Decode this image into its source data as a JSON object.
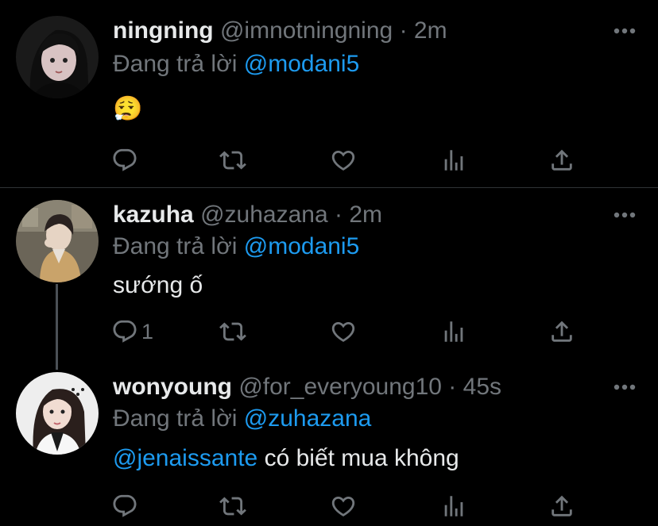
{
  "colors": {
    "background": "#000000",
    "text": "#e7e9ea",
    "muted": "#71767b",
    "link": "#1d9bf0",
    "divider": "#2f3336"
  },
  "tweets": [
    {
      "name": "ningning",
      "handle": "@imnotningning",
      "separator": "·",
      "time": "2m",
      "replying_prefix": "Đang trả lời",
      "replying_to": "@modani5",
      "text": "😮‍💨",
      "reply_count": "",
      "more_icon": "more-horizontal-icon",
      "action_icons": [
        "reply-icon",
        "retweet-icon",
        "like-icon",
        "analytics-icon",
        "share-icon"
      ]
    },
    {
      "name": "kazuha",
      "handle": "@zuhazana",
      "separator": "·",
      "time": "2m",
      "replying_prefix": "Đang trả lời",
      "replying_to": "@modani5",
      "text": "sướng ố",
      "reply_count": "1",
      "more_icon": "more-horizontal-icon",
      "action_icons": [
        "reply-icon",
        "retweet-icon",
        "like-icon",
        "analytics-icon",
        "share-icon"
      ]
    },
    {
      "name": "wonyoung",
      "handle": "@for_everyoung10",
      "separator": "·",
      "time": "45s",
      "replying_prefix": "Đang trả lời",
      "replying_to": "@zuhazana",
      "text_mention": "@jenaissante",
      "text": " có biết mua không",
      "reply_count": "",
      "more_icon": "more-horizontal-icon",
      "action_icons": [
        "reply-icon",
        "retweet-icon",
        "like-icon",
        "analytics-icon",
        "share-icon"
      ]
    }
  ]
}
